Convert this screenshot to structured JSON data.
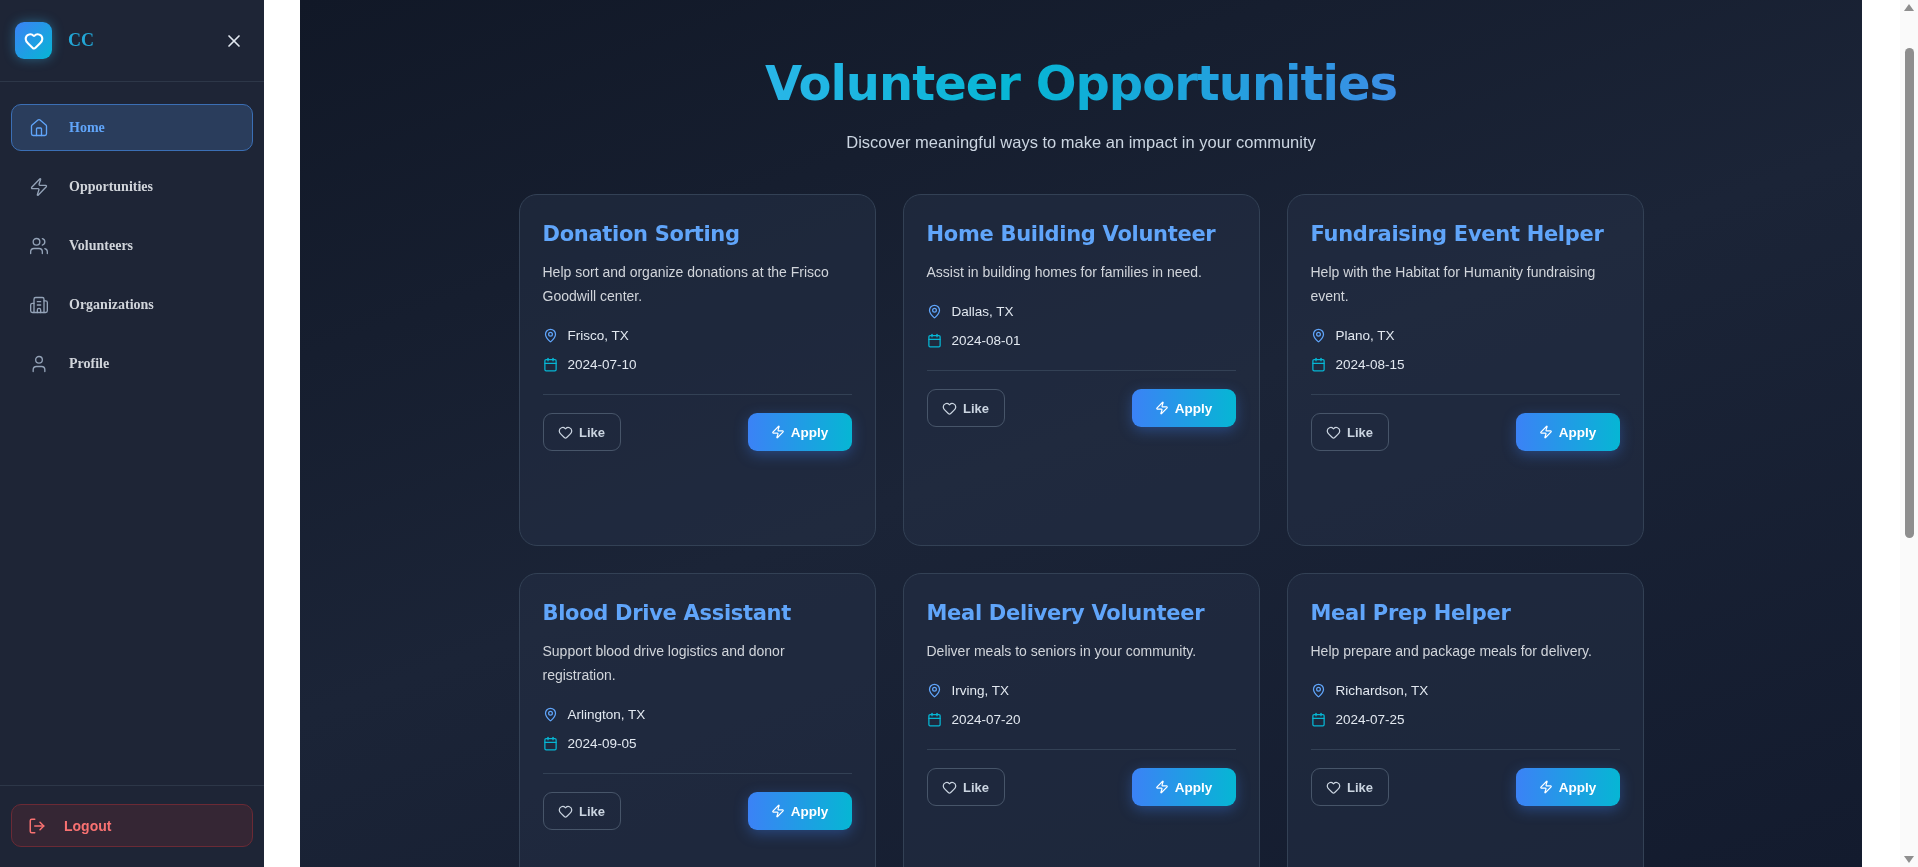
{
  "sidebar": {
    "brand": "CC",
    "items": [
      {
        "label": "Home",
        "selected": true
      },
      {
        "label": "Opportunities",
        "selected": false
      },
      {
        "label": "Volunteers",
        "selected": false
      },
      {
        "label": "Organizations",
        "selected": false
      },
      {
        "label": "Profile",
        "selected": false
      }
    ],
    "logout": "Logout"
  },
  "header": {
    "title": "Volunteer Opportunities",
    "subtitle": "Discover meaningful ways to make an impact in your community"
  },
  "opportunities": [
    {
      "title": "Donation Sorting",
      "description": "Help sort and organize donations at the Frisco Goodwill center.",
      "location": "Frisco, TX",
      "date": "2024-07-10",
      "like": "Like",
      "liked": false,
      "apply": "Apply"
    },
    {
      "title": "Home Building Volunteer",
      "description": "Assist in building homes for families in need.",
      "location": "Dallas, TX",
      "date": "2024-08-01",
      "like": "Like",
      "liked": false,
      "apply": "Apply"
    },
    {
      "title": "Fundraising Event Helper",
      "description": "Help with the Habitat for Humanity fundraising event.",
      "location": "Plano, TX",
      "date": "2024-08-15",
      "like": "Like",
      "liked": false,
      "apply": "Apply"
    },
    {
      "title": "Blood Drive Assistant",
      "description": "Support blood drive logistics and donor registration.",
      "location": "Arlington, TX",
      "date": "2024-09-05",
      "like": "Like",
      "liked": false,
      "apply": "Apply"
    },
    {
      "title": "Meal Delivery Volunteer",
      "description": "Deliver meals to seniors in your community.",
      "location": "Irving, TX",
      "date": "2024-07-20",
      "like": "Like",
      "liked": false,
      "apply": "Apply"
    },
    {
      "title": "Meal Prep Helper",
      "description": "Help prepare and package meals for delivery.",
      "location": "Richardson, TX",
      "date": "2024-07-25",
      "like": "Like",
      "liked": false,
      "apply": "Apply"
    }
  ]
}
